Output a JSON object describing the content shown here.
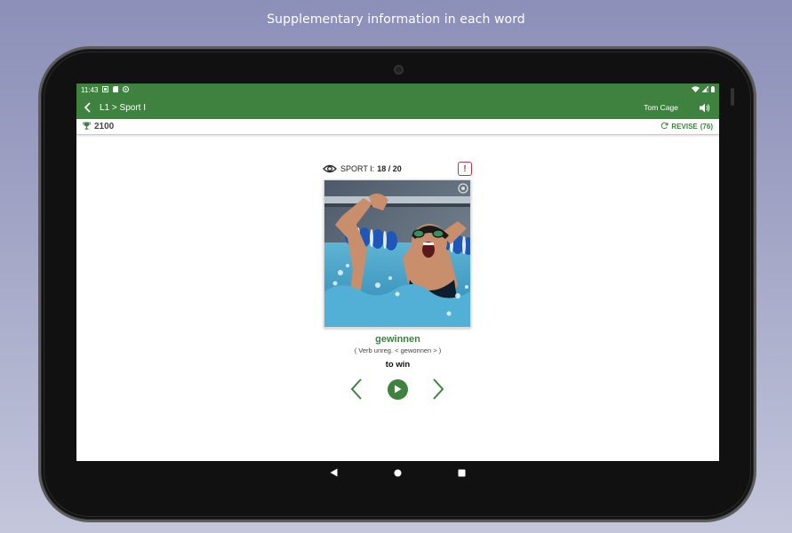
{
  "caption": "Supplementary information in each word",
  "status_bar": {
    "time": "11:43"
  },
  "app_bar": {
    "breadcrumb": "L1 > Sport I",
    "user": "Tom Cage"
  },
  "score_bar": {
    "score": "2100",
    "revise_label": "REVISE",
    "revise_count": "(76)"
  },
  "card": {
    "deck_label": "SPORT I:",
    "progress": "18 / 20",
    "report_label": "!",
    "word": "gewinnen",
    "grammar": "( Verb unreg. < gewonnen > )",
    "translation": "to win"
  },
  "colors": {
    "brand": "#3f8240",
    "report": "#b3394a",
    "background_top": "#8c8fb8"
  },
  "icons": {
    "back": "back-arrow-icon",
    "sound": "speaker-icon",
    "trophy": "trophy-icon",
    "revise": "refresh-icon",
    "eye": "eye-icon",
    "prev": "chevron-left-icon",
    "play": "play-icon",
    "next": "chevron-right-icon"
  }
}
